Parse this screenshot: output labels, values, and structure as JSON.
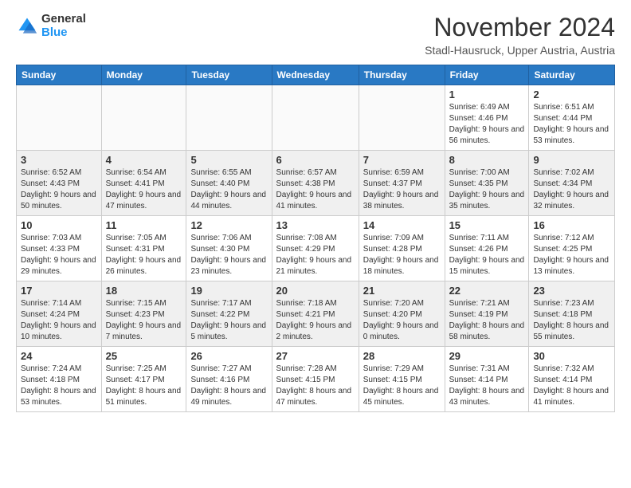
{
  "header": {
    "logo": {
      "general": "General",
      "blue": "Blue"
    },
    "title": "November 2024",
    "location": "Stadl-Hausruck, Upper Austria, Austria"
  },
  "weekdays": [
    "Sunday",
    "Monday",
    "Tuesday",
    "Wednesday",
    "Thursday",
    "Friday",
    "Saturday"
  ],
  "weeks": [
    [
      {
        "day": "",
        "info": ""
      },
      {
        "day": "",
        "info": ""
      },
      {
        "day": "",
        "info": ""
      },
      {
        "day": "",
        "info": ""
      },
      {
        "day": "",
        "info": ""
      },
      {
        "day": "1",
        "info": "Sunrise: 6:49 AM\nSunset: 4:46 PM\nDaylight: 9 hours and 56 minutes."
      },
      {
        "day": "2",
        "info": "Sunrise: 6:51 AM\nSunset: 4:44 PM\nDaylight: 9 hours and 53 minutes."
      }
    ],
    [
      {
        "day": "3",
        "info": "Sunrise: 6:52 AM\nSunset: 4:43 PM\nDaylight: 9 hours and 50 minutes."
      },
      {
        "day": "4",
        "info": "Sunrise: 6:54 AM\nSunset: 4:41 PM\nDaylight: 9 hours and 47 minutes."
      },
      {
        "day": "5",
        "info": "Sunrise: 6:55 AM\nSunset: 4:40 PM\nDaylight: 9 hours and 44 minutes."
      },
      {
        "day": "6",
        "info": "Sunrise: 6:57 AM\nSunset: 4:38 PM\nDaylight: 9 hours and 41 minutes."
      },
      {
        "day": "7",
        "info": "Sunrise: 6:59 AM\nSunset: 4:37 PM\nDaylight: 9 hours and 38 minutes."
      },
      {
        "day": "8",
        "info": "Sunrise: 7:00 AM\nSunset: 4:35 PM\nDaylight: 9 hours and 35 minutes."
      },
      {
        "day": "9",
        "info": "Sunrise: 7:02 AM\nSunset: 4:34 PM\nDaylight: 9 hours and 32 minutes."
      }
    ],
    [
      {
        "day": "10",
        "info": "Sunrise: 7:03 AM\nSunset: 4:33 PM\nDaylight: 9 hours and 29 minutes."
      },
      {
        "day": "11",
        "info": "Sunrise: 7:05 AM\nSunset: 4:31 PM\nDaylight: 9 hours and 26 minutes."
      },
      {
        "day": "12",
        "info": "Sunrise: 7:06 AM\nSunset: 4:30 PM\nDaylight: 9 hours and 23 minutes."
      },
      {
        "day": "13",
        "info": "Sunrise: 7:08 AM\nSunset: 4:29 PM\nDaylight: 9 hours and 21 minutes."
      },
      {
        "day": "14",
        "info": "Sunrise: 7:09 AM\nSunset: 4:28 PM\nDaylight: 9 hours and 18 minutes."
      },
      {
        "day": "15",
        "info": "Sunrise: 7:11 AM\nSunset: 4:26 PM\nDaylight: 9 hours and 15 minutes."
      },
      {
        "day": "16",
        "info": "Sunrise: 7:12 AM\nSunset: 4:25 PM\nDaylight: 9 hours and 13 minutes."
      }
    ],
    [
      {
        "day": "17",
        "info": "Sunrise: 7:14 AM\nSunset: 4:24 PM\nDaylight: 9 hours and 10 minutes."
      },
      {
        "day": "18",
        "info": "Sunrise: 7:15 AM\nSunset: 4:23 PM\nDaylight: 9 hours and 7 minutes."
      },
      {
        "day": "19",
        "info": "Sunrise: 7:17 AM\nSunset: 4:22 PM\nDaylight: 9 hours and 5 minutes."
      },
      {
        "day": "20",
        "info": "Sunrise: 7:18 AM\nSunset: 4:21 PM\nDaylight: 9 hours and 2 minutes."
      },
      {
        "day": "21",
        "info": "Sunrise: 7:20 AM\nSunset: 4:20 PM\nDaylight: 9 hours and 0 minutes."
      },
      {
        "day": "22",
        "info": "Sunrise: 7:21 AM\nSunset: 4:19 PM\nDaylight: 8 hours and 58 minutes."
      },
      {
        "day": "23",
        "info": "Sunrise: 7:23 AM\nSunset: 4:18 PM\nDaylight: 8 hours and 55 minutes."
      }
    ],
    [
      {
        "day": "24",
        "info": "Sunrise: 7:24 AM\nSunset: 4:18 PM\nDaylight: 8 hours and 53 minutes."
      },
      {
        "day": "25",
        "info": "Sunrise: 7:25 AM\nSunset: 4:17 PM\nDaylight: 8 hours and 51 minutes."
      },
      {
        "day": "26",
        "info": "Sunrise: 7:27 AM\nSunset: 4:16 PM\nDaylight: 8 hours and 49 minutes."
      },
      {
        "day": "27",
        "info": "Sunrise: 7:28 AM\nSunset: 4:15 PM\nDaylight: 8 hours and 47 minutes."
      },
      {
        "day": "28",
        "info": "Sunrise: 7:29 AM\nSunset: 4:15 PM\nDaylight: 8 hours and 45 minutes."
      },
      {
        "day": "29",
        "info": "Sunrise: 7:31 AM\nSunset: 4:14 PM\nDaylight: 8 hours and 43 minutes."
      },
      {
        "day": "30",
        "info": "Sunrise: 7:32 AM\nSunset: 4:14 PM\nDaylight: 8 hours and 41 minutes."
      }
    ]
  ]
}
